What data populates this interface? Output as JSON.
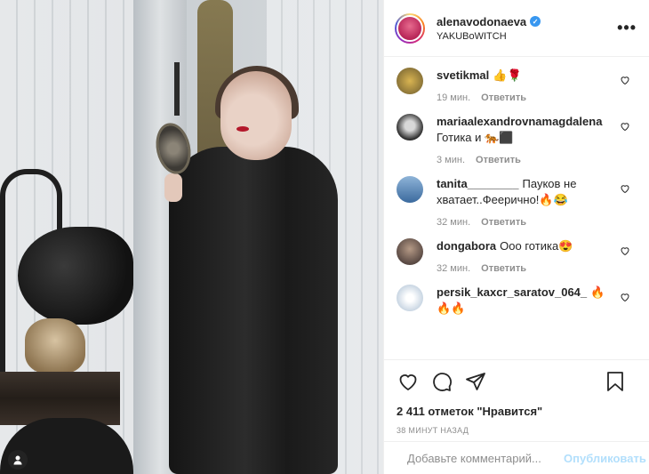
{
  "post": {
    "username": "alenavodonaeva",
    "location": "YAKUBoWITCH",
    "verified_icon": "verified-badge-icon",
    "more_icon": "more-options-icon",
    "more_label": "•••"
  },
  "comments": [
    {
      "user": "svetikmal",
      "text": "👍🌹",
      "time": "19 мин.",
      "reply": "Ответить",
      "avatar_color": "#6b5a2e"
    },
    {
      "user": "mariaalexandrovnamagdalena",
      "text": "Готика и 🐅⬛",
      "time": "3 мин.",
      "reply": "Ответить",
      "avatar_color": "#2a2a2a"
    },
    {
      "user": "tanita________",
      "text": "Пауков не хватает..Феерично!🔥😂",
      "time": "32 мин.",
      "reply": "Ответить",
      "avatar_color": "#3b6a9e"
    },
    {
      "user": "dongabora",
      "text": "Ооо готика😍",
      "time": "32 мин.",
      "reply": "Ответить",
      "avatar_color": "#5a4a44"
    },
    {
      "user": "persik_kaxcr_saratov_064_",
      "text": "🔥🔥🔥",
      "time": "",
      "reply": "",
      "avatar_color": "#c9d6e3"
    }
  ],
  "actions": {
    "like_icon": "heart-icon",
    "comment_icon": "comment-icon",
    "share_icon": "share-icon",
    "save_icon": "bookmark-icon",
    "likes_text": "2 411 отметок \"Нравится\"",
    "time_ago": "38 МИНУТ НАЗАД"
  },
  "add_comment": {
    "placeholder": "Добавьте комментарий...",
    "publish_label": "Опубликовать",
    "emoji_icon": "emoji-icon"
  },
  "colors": {
    "accent": "#3897f0",
    "publish_disabled": "#b2dffc",
    "muted": "#8e8e8e",
    "text": "#262626"
  }
}
